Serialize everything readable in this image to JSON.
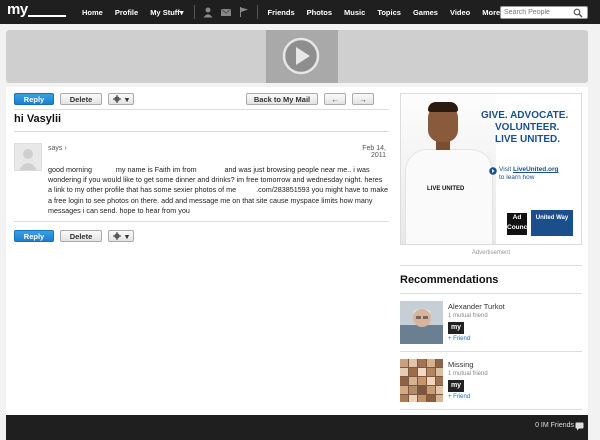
{
  "nav": {
    "logo": "my",
    "items": [
      "Home",
      "Profile",
      "My Stuff▾"
    ],
    "items2": [
      "Friends",
      "Photos",
      "Music",
      "Topics",
      "Games",
      "Video",
      "More▾"
    ],
    "search_placeholder": "Search People"
  },
  "toolbar": {
    "reply": "Reply",
    "delete": "Delete",
    "gear_caret": "▾",
    "back": "Back to My Mail",
    "prev": "←",
    "next": "→"
  },
  "message": {
    "subject": "hi Vasylii",
    "says": "says ›",
    "date": "Feb 14, 2011",
    "body": "good morning            my name is Faith im from              and was just browsing people near me.. i was wondering if you would like to get some dinner and drinks? im free tomorrow and wednesday night. heres a link to my other profile that has some sexier photos of me          .com/283851593 you might have to make a free login to see photos on there. add and message me on that site cause myspace limits how many messages i can send. hope to hear from you"
  },
  "ad": {
    "headline_lines": [
      "GIVE. ADVOCATE.",
      "VOLUNTEER.",
      "LIVE UNITED."
    ],
    "visit_prefix": "Visit ",
    "visit_link": "LiveUnited.org",
    "visit_suffix": "to learn how",
    "shirt_text": "LIVE UNITED",
    "adcouncil": "Ad Council",
    "unitedway": "United Way",
    "label": "Advertisement"
  },
  "recommendations": {
    "title": "Recommendations",
    "items": [
      {
        "name": "Alexander Turkot",
        "mutual": "1 mutual friend",
        "badge": "my",
        "action": "+ Friend"
      },
      {
        "name": "Missing",
        "mutual": "1 mutual friend",
        "badge": "my",
        "action": "+ Friend"
      }
    ]
  },
  "footer": {
    "im": "0 IM Friends"
  },
  "colors": {
    "nav_bg": "#1f1f1f",
    "reply_blue": "#1c7fd0",
    "ad_blue": "#1b4f8c",
    "link_blue": "#2a6ab8"
  }
}
